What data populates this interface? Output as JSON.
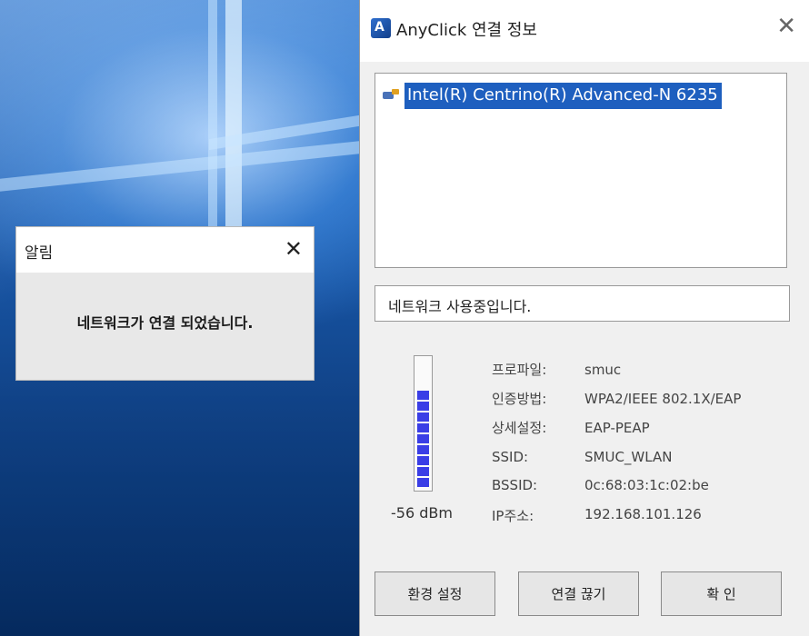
{
  "notification": {
    "title": "알림",
    "close_glyph": "✕",
    "message": "네트워크가 연결 되었습니다."
  },
  "window": {
    "title": "AnyClick 연결 정보",
    "close_glyph": "✕",
    "icon": "anyclick-app-icon"
  },
  "adapter": {
    "name": "Intel(R) Centrino(R) Advanced-N 6235",
    "icon": "network-adapter-icon",
    "selected": true
  },
  "status": {
    "text": "네트워크 사용중입니다."
  },
  "signal": {
    "dbm": "-56 dBm",
    "filled_bars": 9,
    "total_bars": 12,
    "bar_color": "#3a3ee6"
  },
  "info": [
    {
      "label": "프로파일:",
      "value": "smuc"
    },
    {
      "label": "인증방법:",
      "value": "WPA2/IEEE 802.1X/EAP"
    },
    {
      "label": "상세설정:",
      "value": "EAP-PEAP"
    },
    {
      "label": "SSID:",
      "value": "SMUC_WLAN"
    },
    {
      "label": "BSSID:",
      "value": "0c:68:03:1c:02:be"
    },
    {
      "label": "IP주소:",
      "value": "192.168.101.126"
    }
  ],
  "buttons": {
    "settings": "환경 설정",
    "disconnect": "연결 끊기",
    "ok": "확 인"
  },
  "colors": {
    "selection": "#1e5fbf",
    "desktop": "#0a4fa8"
  }
}
